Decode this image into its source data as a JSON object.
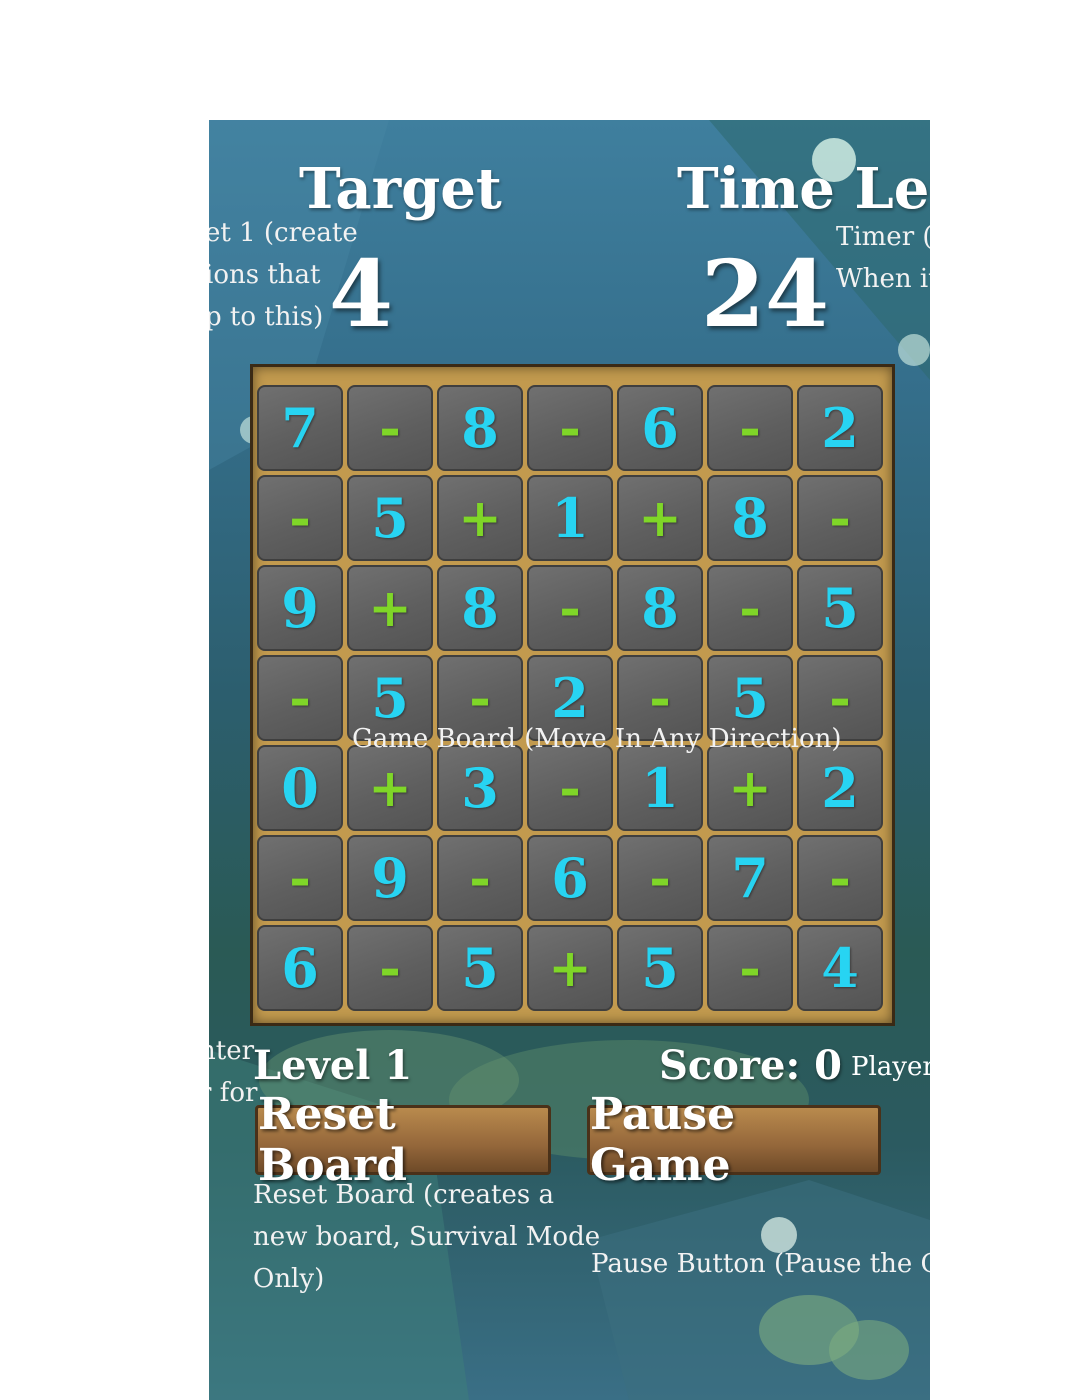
{
  "header": {
    "target_label": "Target",
    "target_value": "4",
    "time_label": "Time Left",
    "time_value": "24",
    "target_note_lines": [
      "et 1 (create",
      "ions that",
      "p to this)"
    ],
    "timer_note_lines": [
      "Timer (",
      "When it"
    ]
  },
  "board": {
    "overlay_label": "Game Board (Move In Any Direction)",
    "rows": [
      [
        "7",
        "-",
        "8",
        "-",
        "6",
        "-",
        "2"
      ],
      [
        "-",
        "5",
        "+",
        "1",
        "+",
        "8",
        "-"
      ],
      [
        "9",
        "+",
        "8",
        "-",
        "8",
        "-",
        "5"
      ],
      [
        "-",
        "5",
        "-",
        "2",
        "-",
        "5",
        "-"
      ],
      [
        "0",
        "+",
        "3",
        "-",
        "1",
        "+",
        "2"
      ],
      [
        "-",
        "9",
        "-",
        "6",
        "-",
        "7",
        "-"
      ],
      [
        "6",
        "-",
        "5",
        "+",
        "5",
        "-",
        "4"
      ]
    ],
    "colors": {
      "digit": "#27d4f2",
      "operator": "#7fd628"
    }
  },
  "footer": {
    "level_text": "Level 1",
    "score_text": "Score: 0",
    "player_text": "Player",
    "left_note_lines": [
      "nter",
      "r for"
    ],
    "reset_label": "Reset Board",
    "pause_label": "Pause Game",
    "reset_note_lines": [
      "Reset Board (creates a",
      "new board, Survival Mode",
      "Only)"
    ],
    "pause_note": "Pause Button (Pause the G"
  }
}
